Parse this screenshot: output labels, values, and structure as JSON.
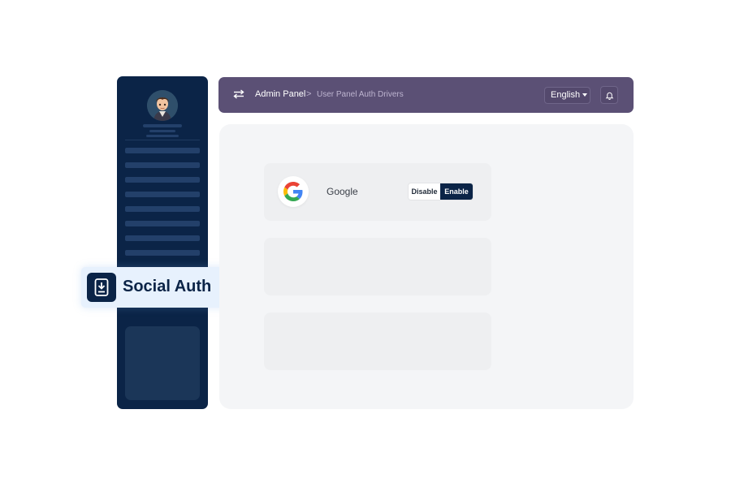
{
  "topbar": {
    "breadcrumb_home": "Admin Panel",
    "breadcrumb_separator": ">",
    "breadcrumb_current": "User Panel Auth Drivers",
    "language": "English",
    "bg_color": "#5b5075"
  },
  "sidebar": {
    "bg_color": "#0b2447",
    "feature_tag": {
      "label": "Social Auth",
      "icon": "mobile-download-icon"
    }
  },
  "main": {
    "drivers": [
      {
        "name": "Google",
        "icon": "google-icon",
        "disable_label": "Disable",
        "enable_label": "Enable",
        "status": "enabled"
      }
    ]
  },
  "colors": {
    "accent": "#0b2447",
    "tag_bg": "#e7f1fd"
  }
}
